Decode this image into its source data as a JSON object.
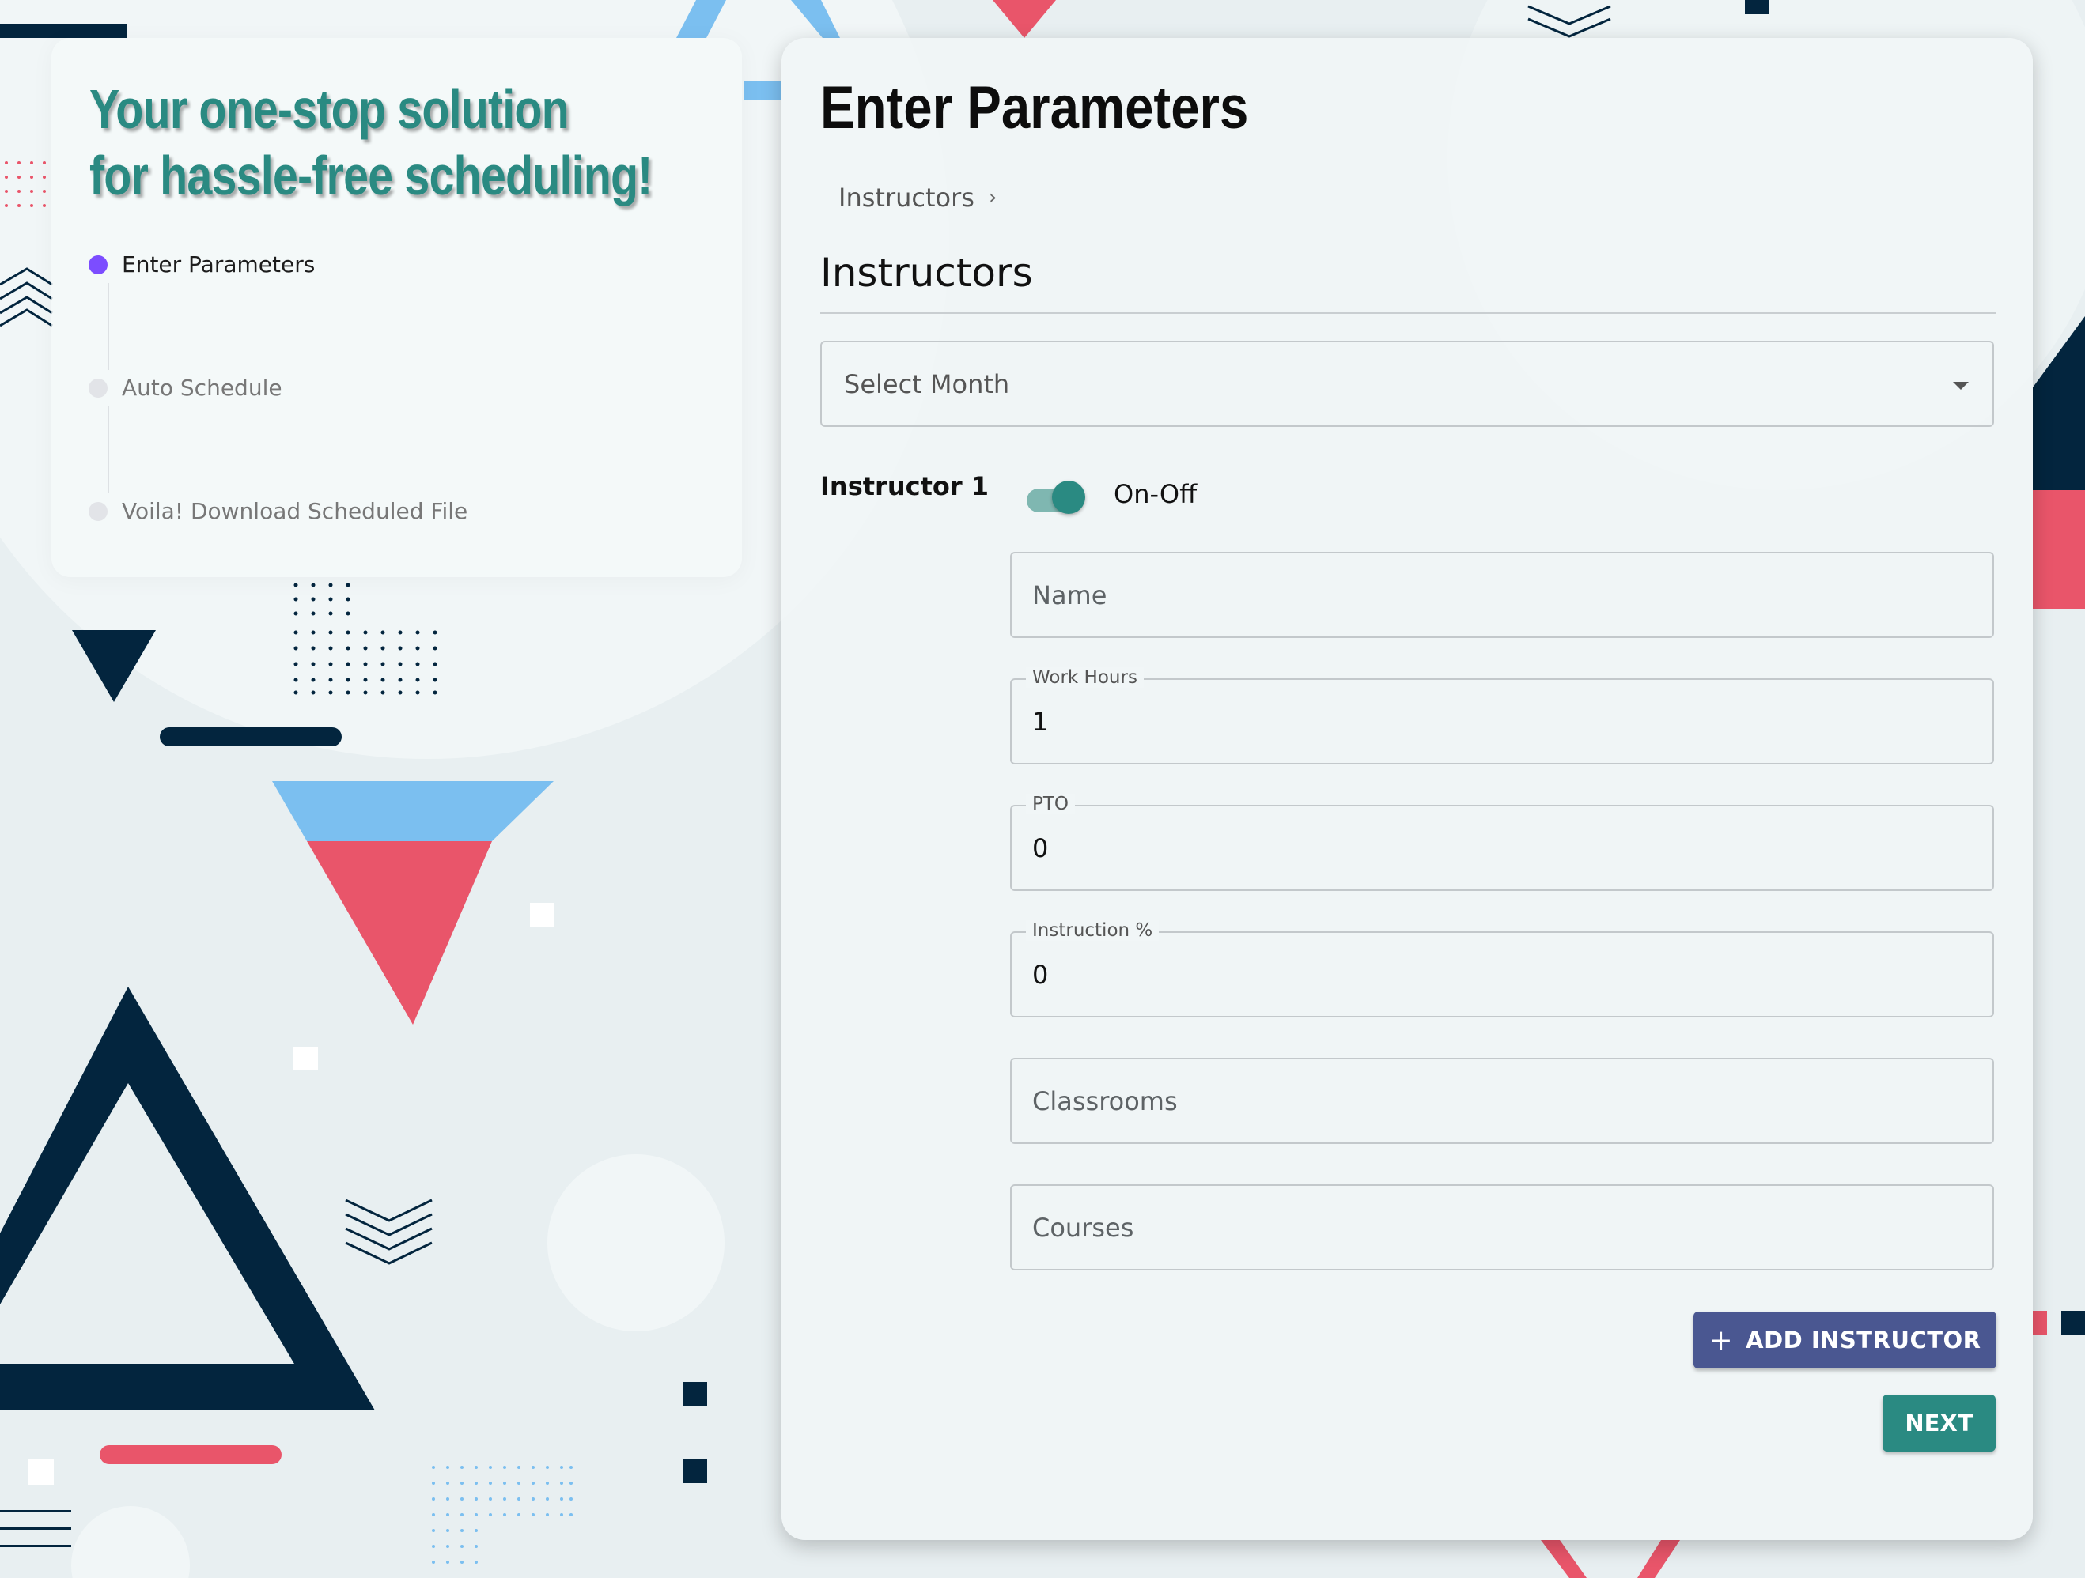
{
  "colors": {
    "accent_teal": "#2a8a82",
    "accent_indigo": "#4a5791",
    "active_step": "#7c4dff",
    "navy": "#03253e",
    "coral": "#e9556a",
    "sky": "#7bbff0"
  },
  "hero": {
    "tagline_line1": "Your one-stop solution",
    "tagline_line2": "for hassle-free scheduling!",
    "steps": [
      {
        "label": "Enter Parameters",
        "active": true
      },
      {
        "label": "Auto Schedule",
        "active": false
      },
      {
        "label": "Voila! Download Scheduled File",
        "active": false
      }
    ]
  },
  "panel": {
    "title": "Enter Parameters",
    "breadcrumb": "Instructors",
    "breadcrumb_sep": "›",
    "section_title": "Instructors",
    "month_select": {
      "placeholder": "Select Month",
      "icon": "arrow-drop-down-icon"
    },
    "instructor": {
      "label": "Instructor 1",
      "toggle_label": "On-Off",
      "toggle_on": true
    },
    "fields": {
      "name": {
        "placeholder": "Name"
      },
      "work_hours": {
        "label": "Work Hours",
        "value": "1"
      },
      "pto": {
        "label": "PTO",
        "value": "0"
      },
      "instruction": {
        "label": "Instruction %",
        "value": "0"
      },
      "classrooms": {
        "placeholder": "Classrooms"
      },
      "courses": {
        "placeholder": "Courses"
      }
    },
    "add_button": {
      "icon": "plus-icon",
      "glyph": "+",
      "label": "ADD INSTRUCTOR"
    },
    "next_button": {
      "label": "NEXT"
    }
  }
}
